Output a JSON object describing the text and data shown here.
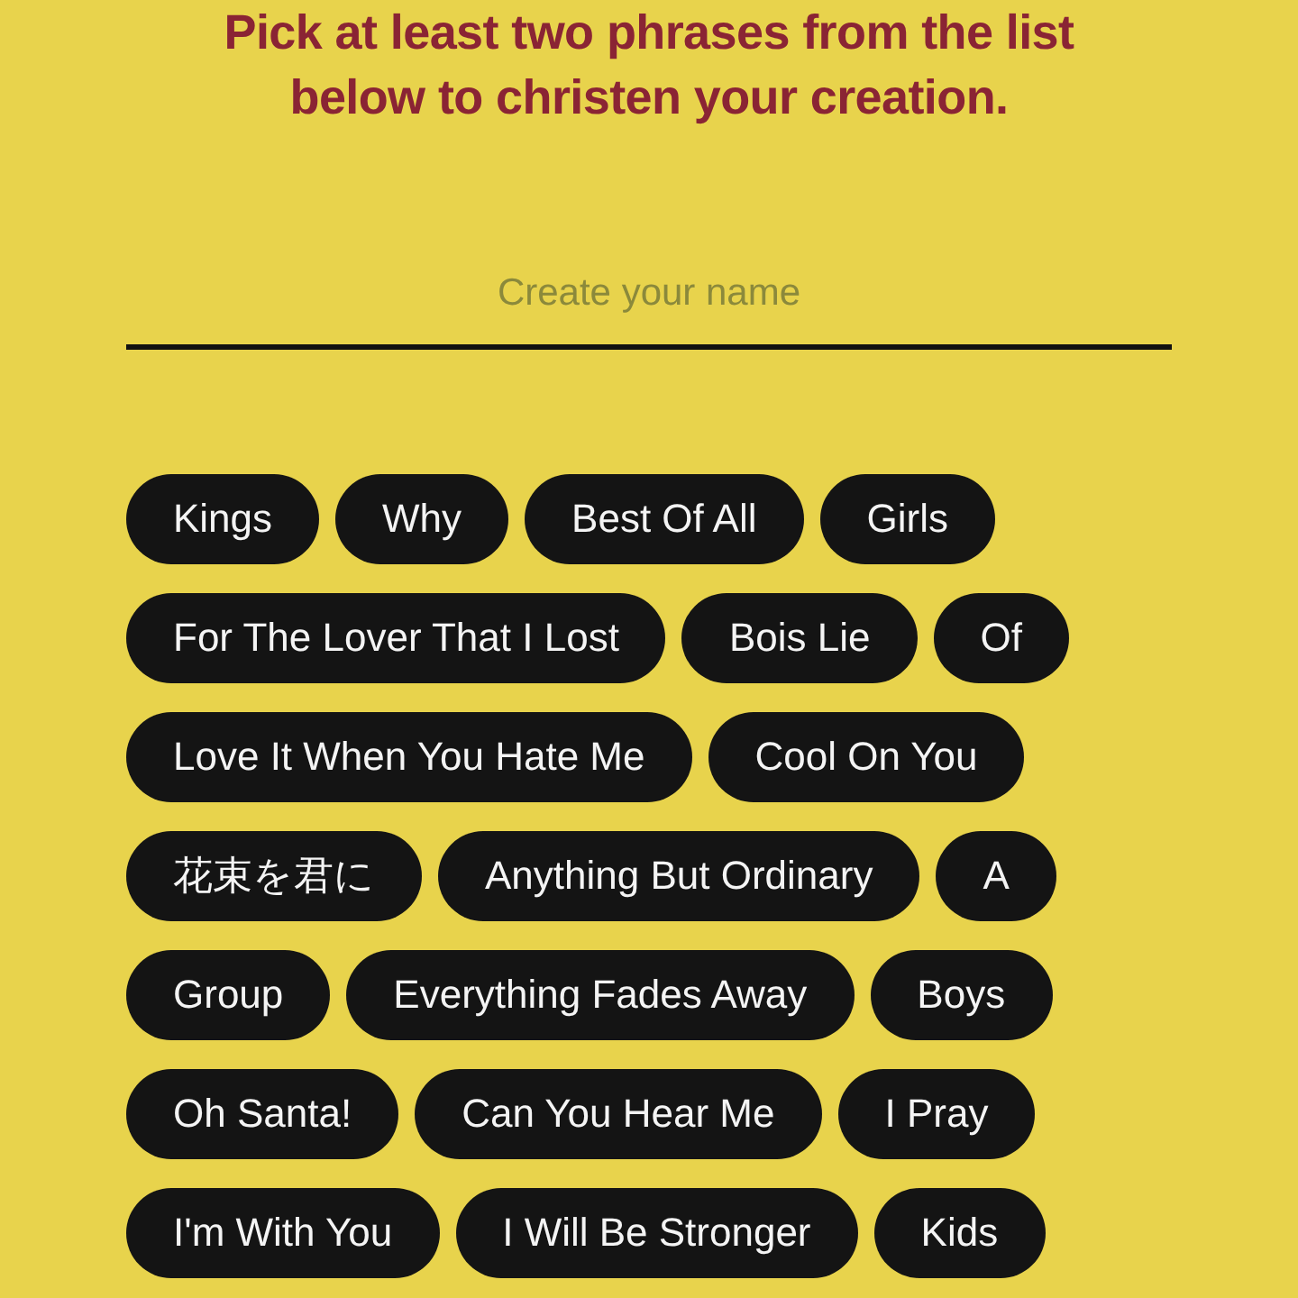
{
  "heading": "Pick at least two phrases from the list below to christen your creation.",
  "name_field": {
    "placeholder": "Create your name"
  },
  "phrase_rows": [
    [
      {
        "label": "Kings",
        "selected": false
      },
      {
        "label": "Why",
        "selected": false
      },
      {
        "label": "Best Of All",
        "selected": false
      },
      {
        "label": "Girls",
        "selected": false
      }
    ],
    [
      {
        "label": "For The Lover That I Lost",
        "selected": false
      },
      {
        "label": "Bois Lie",
        "selected": false
      },
      {
        "label": "Of",
        "selected": false
      }
    ],
    [
      {
        "label": "Love It When You Hate Me",
        "selected": false
      },
      {
        "label": "Cool On You",
        "selected": false
      }
    ],
    [
      {
        "label": "花束を君に",
        "selected": false
      },
      {
        "label": "Anything But Ordinary",
        "selected": false
      },
      {
        "label": "A",
        "selected": false
      }
    ],
    [
      {
        "label": "Group",
        "selected": false
      },
      {
        "label": "Everything Fades Away",
        "selected": false
      },
      {
        "label": "Boys",
        "selected": false
      }
    ],
    [
      {
        "label": "Oh Santa!",
        "selected": false
      },
      {
        "label": "Can You Hear Me",
        "selected": false
      },
      {
        "label": "I Pray",
        "selected": false
      }
    ],
    [
      {
        "label": "I'm With You",
        "selected": false
      },
      {
        "label": "I Will Be Stronger",
        "selected": false
      },
      {
        "label": "Kids",
        "selected": false
      }
    ]
  ]
}
